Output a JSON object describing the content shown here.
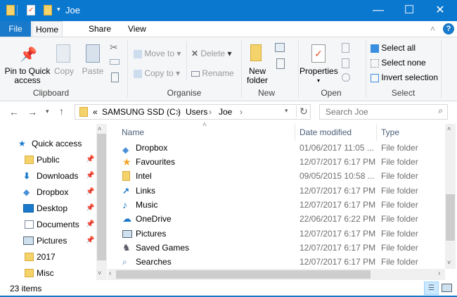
{
  "window": {
    "title": "Joe"
  },
  "tabs": {
    "file": "File",
    "home": "Home",
    "share": "Share",
    "view": "View"
  },
  "ribbon": {
    "clipboard": {
      "label": "Clipboard",
      "pin_line1": "Pin to Quick",
      "pin_line2": "access",
      "copy": "Copy",
      "paste": "Paste"
    },
    "organise": {
      "label": "Organise",
      "move_to": "Move to",
      "copy_to": "Copy to",
      "delete": "Delete",
      "rename": "Rename"
    },
    "new": {
      "label": "New",
      "new_folder_line1": "New",
      "new_folder_line2": "folder"
    },
    "open": {
      "label": "Open",
      "properties": "Properties"
    },
    "select": {
      "label": "Select",
      "select_all": "Select all",
      "select_none": "Select none",
      "invert": "Invert selection"
    }
  },
  "address": {
    "overflow": "«",
    "crumbs": [
      "SAMSUNG SSD (C:)",
      "Users",
      "Joe"
    ],
    "search_placeholder": "Search Joe"
  },
  "nav": {
    "quick_access": "Quick access",
    "items": [
      {
        "label": "Public",
        "pinned": true
      },
      {
        "label": "Downloads",
        "pinned": true
      },
      {
        "label": "Dropbox",
        "pinned": true
      },
      {
        "label": "Desktop",
        "pinned": true
      },
      {
        "label": "Documents",
        "pinned": true
      },
      {
        "label": "Pictures",
        "pinned": true
      },
      {
        "label": "2017",
        "pinned": false
      },
      {
        "label": "Misc",
        "pinned": false
      }
    ]
  },
  "columns": {
    "name": "Name",
    "date": "Date modified",
    "type": "Type"
  },
  "files": [
    {
      "name": "Dropbox",
      "date": "01/06/2017 11:05 ...",
      "type": "File folder",
      "icon": "dropbox-icon"
    },
    {
      "name": "Favourites",
      "date": "12/07/2017 6:17 PM",
      "type": "File folder",
      "icon": "star-icon"
    },
    {
      "name": "Intel",
      "date": "09/05/2015 10:58 ...",
      "type": "File folder",
      "icon": "folder-icon"
    },
    {
      "name": "Links",
      "date": "12/07/2017 6:17 PM",
      "type": "File folder",
      "icon": "link-arrow-icon"
    },
    {
      "name": "Music",
      "date": "12/07/2017 6:17 PM",
      "type": "File folder",
      "icon": "music-note-icon"
    },
    {
      "name": "OneDrive",
      "date": "22/06/2017 6:22 PM",
      "type": "File folder",
      "icon": "cloud-icon"
    },
    {
      "name": "Pictures",
      "date": "12/07/2017 6:17 PM",
      "type": "File folder",
      "icon": "picture-icon"
    },
    {
      "name": "Saved Games",
      "date": "12/07/2017 6:17 PM",
      "type": "File folder",
      "icon": "game-piece-icon"
    },
    {
      "name": "Searches",
      "date": "12/07/2017 6:17 PM",
      "type": "File folder",
      "icon": "magnifier-icon"
    }
  ],
  "status": {
    "count": "23 items"
  },
  "colors": {
    "titlebar": "#0b78d0",
    "file_tab": "#1979ca"
  }
}
